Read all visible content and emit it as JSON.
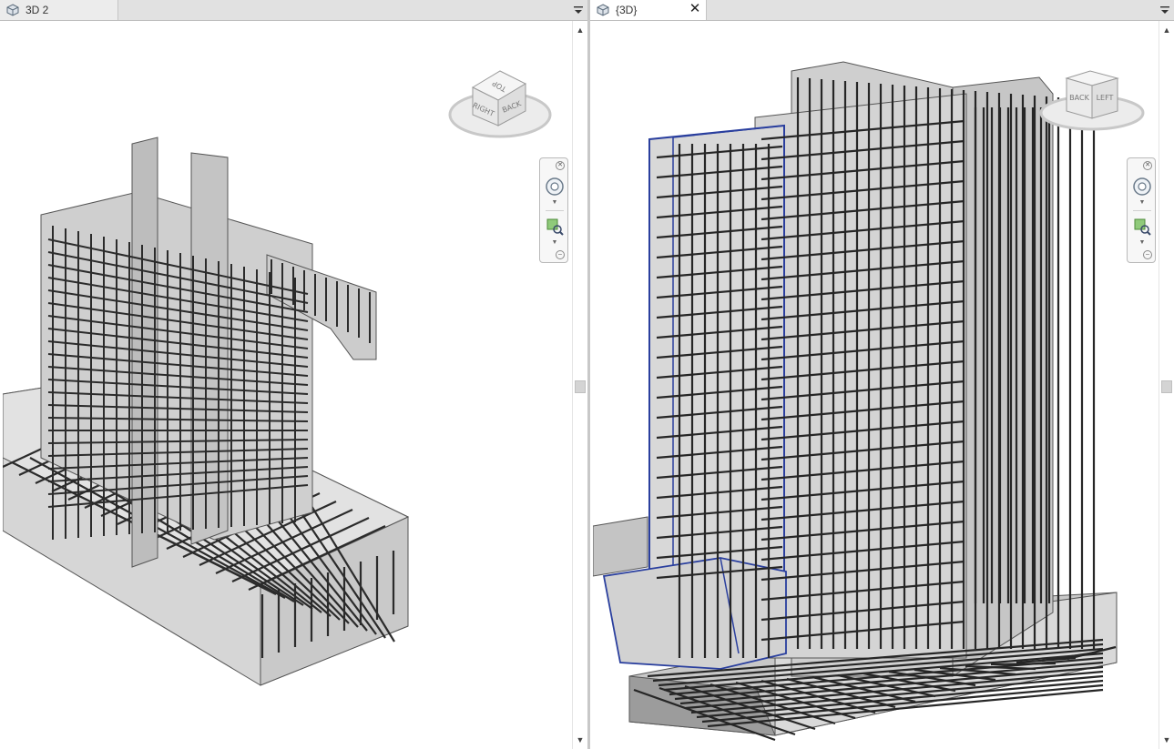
{
  "left_pane": {
    "tab_label": "3D 2",
    "view_icon": "3d-view-icon",
    "viewcube_faces": {
      "top": "TOP",
      "front": "RIGHT",
      "side": "BACK"
    }
  },
  "right_pane": {
    "tab_label": "{3D}",
    "view_icon": "3d-view-icon",
    "close_glyph": "✕",
    "viewcube_faces": {
      "front": "BACK",
      "side": "LEFT"
    }
  },
  "icons": {
    "tab_menu": "dropdown-arrow-icon",
    "wheel": "steering-wheel-icon",
    "zoom": "zoom-region-icon",
    "cube": "viewcube-icon"
  },
  "colors": {
    "selection_blue": "#2a3f9e",
    "concrete": "#d2d2d2",
    "rebar": "#2b2b2b"
  }
}
